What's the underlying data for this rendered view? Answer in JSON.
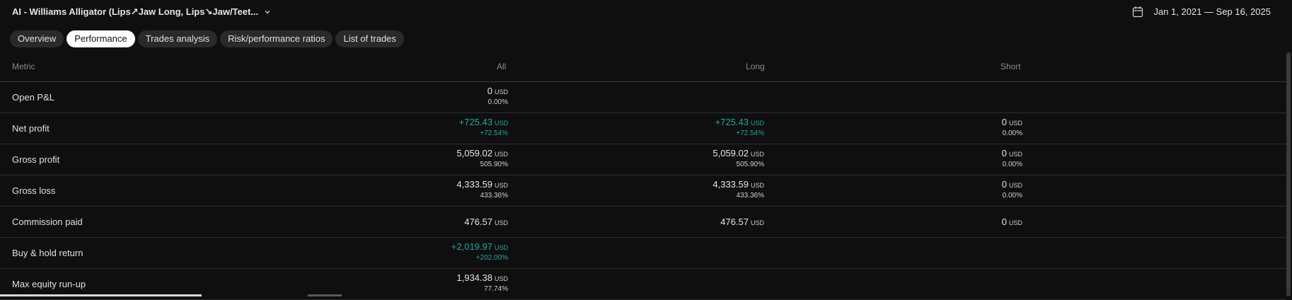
{
  "header": {
    "strategy_title": "AI - Williams Alligator (Lips↗Jaw Long, Lips↘Jaw/Teet...",
    "date_range": "Jan 1, 2021 — Sep 16, 2025"
  },
  "tabs": [
    {
      "label": "Overview"
    },
    {
      "label": "Performance",
      "active": true
    },
    {
      "label": "Trades analysis"
    },
    {
      "label": "Risk/performance ratios"
    },
    {
      "label": "List of trades"
    }
  ],
  "table": {
    "columns": [
      "Metric",
      "All",
      "Long",
      "Short"
    ],
    "rows": [
      {
        "metric": "Open P&L",
        "all": {
          "value": "0",
          "unit": "USD",
          "pct": "0.00%"
        },
        "long": null,
        "short": null
      },
      {
        "metric": "Net profit",
        "all": {
          "value": "+725.43",
          "unit": "USD",
          "pct": "+72.54%",
          "positive": true
        },
        "long": {
          "value": "+725.43",
          "unit": "USD",
          "pct": "+72.54%",
          "positive": true
        },
        "short": {
          "value": "0",
          "unit": "USD",
          "pct": "0.00%"
        }
      },
      {
        "metric": "Gross profit",
        "all": {
          "value": "5,059.02",
          "unit": "USD",
          "pct": "505.90%"
        },
        "long": {
          "value": "5,059.02",
          "unit": "USD",
          "pct": "505.90%"
        },
        "short": {
          "value": "0",
          "unit": "USD",
          "pct": "0.00%"
        }
      },
      {
        "metric": "Gross loss",
        "all": {
          "value": "4,333.59",
          "unit": "USD",
          "pct": "433.36%"
        },
        "long": {
          "value": "4,333.59",
          "unit": "USD",
          "pct": "433.36%"
        },
        "short": {
          "value": "0",
          "unit": "USD",
          "pct": "0.00%"
        }
      },
      {
        "metric": "Commission paid",
        "all": {
          "value": "476.57",
          "unit": "USD"
        },
        "long": {
          "value": "476.57",
          "unit": "USD"
        },
        "short": {
          "value": "0",
          "unit": "USD"
        }
      },
      {
        "metric": "Buy & hold return",
        "all": {
          "value": "+2,019.97",
          "unit": "USD",
          "pct": "+202.00%",
          "positive": true
        },
        "long": null,
        "short": null
      },
      {
        "metric": "Max equity run-up",
        "all": {
          "value": "1,934.38",
          "unit": "USD",
          "pct": "77.74%"
        },
        "long": null,
        "short": null
      }
    ]
  },
  "icons": {
    "calendar": "calendar-icon",
    "dropdown": "chevron-down-icon"
  },
  "colors": {
    "background": "#0f0f0f",
    "positive": "#26a69a",
    "tab_active_bg": "#ffffff",
    "tab_bg": "#2a2a2a"
  }
}
